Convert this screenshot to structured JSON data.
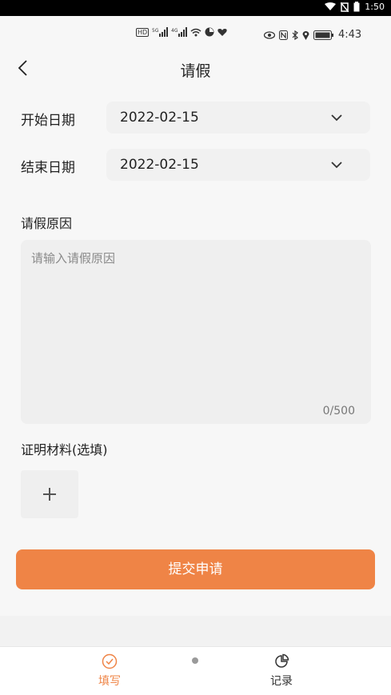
{
  "system_bar": {
    "time": "1:50",
    "battery": "◼"
  },
  "phone_status": {
    "left_icons": [
      "HD",
      "5G",
      "4G",
      "wifi",
      "app",
      "heart"
    ],
    "right_icons": [
      "eye",
      "nfc",
      "bluetooth",
      "location",
      "battery"
    ],
    "time": "4:43"
  },
  "nav": {
    "title": "请假",
    "back_icon": "chevron-left-icon"
  },
  "form": {
    "start_date": {
      "label": "开始日期",
      "value": "2022-02-15"
    },
    "end_date": {
      "label": "结束日期",
      "value": "2022-02-15"
    },
    "reason": {
      "label": "请假原因",
      "placeholder": "请输入请假原因",
      "counter": "0/500"
    },
    "proof": {
      "label": "证明材料(选填)",
      "add_icon": "plus-icon"
    },
    "submit_label": "提交申请"
  },
  "tabbar": {
    "tabs": [
      {
        "label": "填写",
        "icon": "check-circle-icon",
        "active": true
      },
      {
        "label": "记录",
        "icon": "pie-chart-icon",
        "active": false
      }
    ]
  },
  "colors": {
    "accent": "#ef8446",
    "background": "#f7f7f7"
  }
}
